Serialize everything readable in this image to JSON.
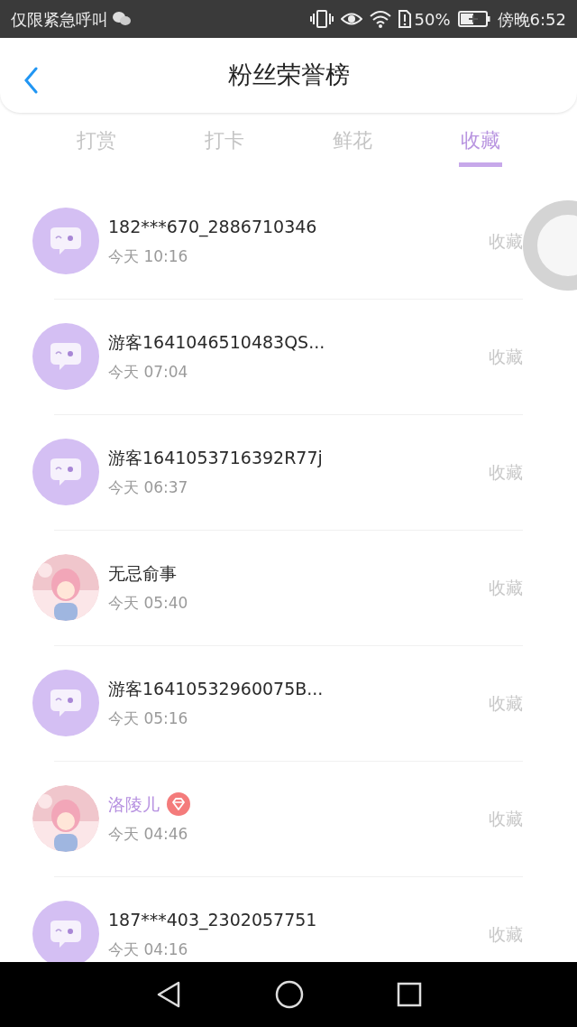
{
  "status_bar": {
    "carrier": "仅限紧急呼叫",
    "battery": "50%",
    "time": "傍晚6:52"
  },
  "header": {
    "title": "粉丝荣誉榜"
  },
  "tabs": [
    {
      "label": "打赏",
      "selected": false
    },
    {
      "label": "打卡",
      "selected": false
    },
    {
      "label": "鲜花",
      "selected": false
    },
    {
      "label": "收藏",
      "selected": true
    }
  ],
  "rows": [
    {
      "avatar": {
        "kind": "default"
      },
      "name": "182***670_2886710346",
      "vip": false,
      "time": "今天 10:16",
      "action": "收藏"
    },
    {
      "avatar": {
        "kind": "default"
      },
      "name": "游客1641046510483QS...",
      "vip": false,
      "time": "今天 07:04",
      "action": "收藏"
    },
    {
      "avatar": {
        "kind": "default"
      },
      "name": "游客1641053716392R77j",
      "vip": false,
      "time": "今天 06:37",
      "action": "收藏"
    },
    {
      "name": "无忌俞事",
      "vip": false,
      "time": "今天 05:40",
      "action": "收藏"
    },
    {
      "avatar": {
        "kind": "default"
      },
      "name": "游客16410532960075B...",
      "vip": false,
      "time": "今天 05:16",
      "action": "收藏"
    },
    {
      "name": "洛陵儿",
      "vip": true,
      "time": "今天 04:46",
      "action": "收藏"
    },
    {
      "avatar": {
        "kind": "default"
      },
      "name": "187***403_2302057751",
      "vip": false,
      "time": "今天 04:16",
      "action": "收藏"
    }
  ]
}
